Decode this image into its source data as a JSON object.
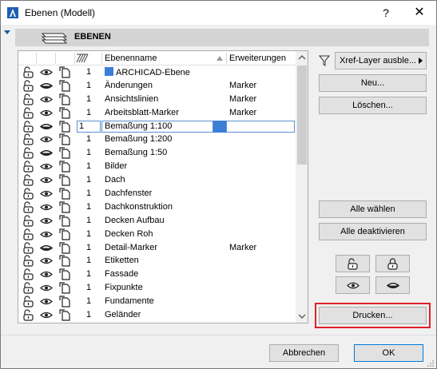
{
  "window": {
    "title": "Ebenen (Modell)",
    "help_label": "?",
    "close_label": "✕"
  },
  "section": {
    "title": "EBENEN"
  },
  "columns": {
    "name": "Ebenenname",
    "extensions": "Erweiterungen"
  },
  "layers": [
    {
      "num": "1",
      "name": "ARCHICAD-Ebene",
      "ext": "",
      "archicad": true
    },
    {
      "num": "1",
      "name": "Änderungen",
      "ext": "Marker"
    },
    {
      "num": "1",
      "name": "Ansichtslinien",
      "ext": "Marker"
    },
    {
      "num": "1",
      "name": "Arbeitsblatt-Marker",
      "ext": "Marker"
    },
    {
      "num": "1",
      "name": "Bemaßung 1:100",
      "ext": "",
      "selected": true
    },
    {
      "num": "1",
      "name": "Bemaßung 1:200",
      "ext": ""
    },
    {
      "num": "1",
      "name": "Bemaßung 1:50",
      "ext": ""
    },
    {
      "num": "1",
      "name": "Bilder",
      "ext": ""
    },
    {
      "num": "1",
      "name": "Dach",
      "ext": ""
    },
    {
      "num": "1",
      "name": "Dachfenster",
      "ext": ""
    },
    {
      "num": "1",
      "name": "Dachkonstruktion",
      "ext": ""
    },
    {
      "num": "1",
      "name": "Decken Aufbau",
      "ext": ""
    },
    {
      "num": "1",
      "name": "Decken Roh",
      "ext": ""
    },
    {
      "num": "1",
      "name": "Detail-Marker",
      "ext": "Marker"
    },
    {
      "num": "1",
      "name": "Etiketten",
      "ext": ""
    },
    {
      "num": "1",
      "name": "Fassade",
      "ext": ""
    },
    {
      "num": "1",
      "name": "Fixpunkte",
      "ext": ""
    },
    {
      "num": "1",
      "name": "Fundamente",
      "ext": ""
    },
    {
      "num": "1",
      "name": "Geländer",
      "ext": ""
    }
  ],
  "side": {
    "xref_label": "Xref-Layer ausble...",
    "new_label": "Neu...",
    "delete_label": "Löschen...",
    "select_all_label": "Alle wählen",
    "deactivate_all_label": "Alle deaktivieren",
    "print_label": "Drucken..."
  },
  "footer": {
    "cancel_label": "Abbrechen",
    "ok_label": "OK"
  },
  "colors": {
    "highlight": "#e0202a",
    "selection": "#3a7fd5",
    "accent": "#0078d7"
  }
}
